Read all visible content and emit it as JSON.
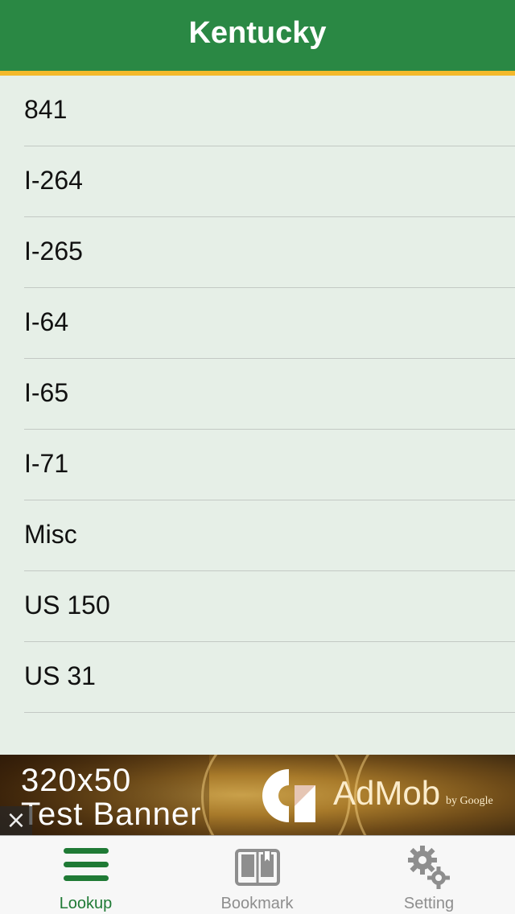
{
  "navbar": {
    "title": "Kentucky",
    "color": "#2a8844",
    "accent_color": "#f3b92b"
  },
  "list": {
    "items": [
      {
        "label": "841"
      },
      {
        "label": "I-264"
      },
      {
        "label": "I-265"
      },
      {
        "label": "I-64"
      },
      {
        "label": "I-65"
      },
      {
        "label": "I-71"
      },
      {
        "label": "Misc"
      },
      {
        "label": "US 150"
      },
      {
        "label": "US 31"
      }
    ]
  },
  "ad": {
    "line1": "320x50",
    "line2": "Test Banner",
    "brand": "AdMob",
    "brand_suffix": "by Google",
    "close_icon": "close-icon"
  },
  "tabbar": {
    "tabs": [
      {
        "label": "Lookup",
        "icon": "list-icon",
        "active": true
      },
      {
        "label": "Bookmark",
        "icon": "book-icon",
        "active": false
      },
      {
        "label": "Setting",
        "icon": "gears-icon",
        "active": false
      }
    ],
    "active_color": "#1f7a35",
    "inactive_color": "#8e8e8e"
  }
}
